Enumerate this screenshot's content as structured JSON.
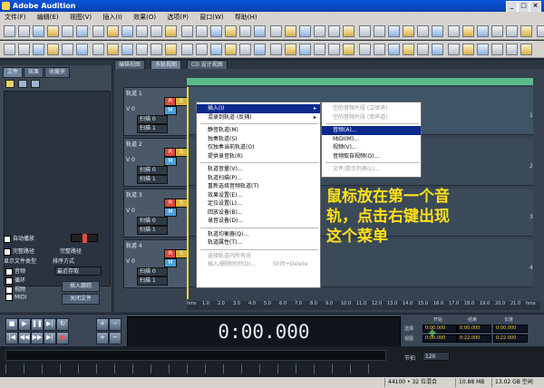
{
  "window": {
    "title": "Adobe Audition",
    "controls": [
      "_",
      "□",
      "×"
    ]
  },
  "menubar": [
    "文件(F)",
    "编辑(E)",
    "视图(V)",
    "插入(I)",
    "效果(O)",
    "选项(P)",
    "窗口(W)",
    "帮助(H)"
  ],
  "organizer": {
    "tabs": [
      "文件",
      "效果",
      "收藏夹"
    ],
    "auto_play_label": "自动播放",
    "full_path_label": "完整路径",
    "show_type_label": "显示文件类型",
    "sort_label": "排序方式",
    "sort_value": "最近存取",
    "file_types": [
      "音频",
      "循环",
      "视频",
      "MIDI"
    ],
    "btn_insert": "插入跟踪",
    "btn_close": "关闭文件"
  },
  "view_tabs": [
    "编辑视图",
    "多轨视图",
    "CD 设计视图"
  ],
  "tracks": [
    {
      "name": "轨道 1",
      "vol": "V 0",
      "rec": "录音",
      "out": "扫描 0",
      "out2": "扫描 1"
    },
    {
      "name": "轨道 2",
      "vol": "V 0",
      "rec": "录音",
      "out": "扫描 0",
      "out2": "扫描 1"
    },
    {
      "name": "轨道 3",
      "vol": "V 0",
      "rec": "录音",
      "out": "扫描 0",
      "out2": "扫描 1"
    },
    {
      "name": "轨道 4",
      "vol": "V 0",
      "rec": "录音",
      "out": "扫描 0",
      "out2": "扫描 1"
    }
  ],
  "track_numbers": [
    "1",
    "2",
    "3",
    "4"
  ],
  "ruler": [
    "hms",
    "1.0",
    "2.0",
    "3.0",
    "4.0",
    "5.0",
    "6.0",
    "7.0",
    "8.0",
    "9.0",
    "10.0",
    "11.0",
    "12.0",
    "13.0",
    "14.0",
    "15.0",
    "16.0",
    "17.0",
    "18.0",
    "19.0",
    "20.0",
    "21.0",
    "hms"
  ],
  "context_menu": {
    "items": [
      {
        "label": "插入(I)",
        "arrow": "▸",
        "highlight": true
      },
      {
        "label": "混录到轨道 (反捕)",
        "arrow": "▸"
      },
      {
        "sep": true
      },
      {
        "label": "静音轨道(M)"
      },
      {
        "label": "独奏轨道(S)"
      },
      {
        "label": "仅独奏当前轨道(O)"
      },
      {
        "label": "提供录音轨(R)"
      },
      {
        "sep": true
      },
      {
        "label": "轨道音量(V)..."
      },
      {
        "label": "轨道扫描(P)..."
      },
      {
        "label": "重新选择音频轨道(T)"
      },
      {
        "label": "效果设置(E)..."
      },
      {
        "label": "定位设置(L)..."
      },
      {
        "label": "回放设备(B)..."
      },
      {
        "label": "录音设备(D)..."
      },
      {
        "sep": true
      },
      {
        "label": "轨道均衡器(Q)..."
      },
      {
        "label": "轨道属性(T)..."
      },
      {
        "sep": true
      },
      {
        "label": "选择轨道内所有块",
        "disabled": true
      },
      {
        "label": "插入/删除时间(D)...",
        "shortcut": "Shift+Delete",
        "disabled": true
      }
    ]
  },
  "submenu": {
    "items": [
      {
        "label": "空的音频片段 (立体声)",
        "disabled": true
      },
      {
        "label": "空的音频片段 (单声道)",
        "disabled": true
      },
      {
        "sep": true
      },
      {
        "label": "音频(A)...",
        "highlight": true
      },
      {
        "label": "MIDI(M)..."
      },
      {
        "label": "视频(V)..."
      },
      {
        "label": "音频取自视频(O)..."
      },
      {
        "sep": true
      },
      {
        "label": "文件/提示列表(L)...",
        "disabled": true
      }
    ]
  },
  "annotation": [
    "鼠标放在第一个音",
    "轨，点击右键出现",
    "这个菜单"
  ],
  "transport": {
    "time": "0:00.000",
    "headers": [
      "开始",
      "结束",
      "长度"
    ],
    "rows": [
      {
        "label": "选择",
        "start": "0:00.000",
        "end": "0:00.000",
        "length": "0:00.000"
      },
      {
        "label": "视图",
        "start": "0:00.000",
        "end": "0:22.000",
        "length": "0:22.000"
      }
    ],
    "tempo_label": "节拍",
    "tempo_value": "120"
  },
  "statusbar": [
    "44100 • 32 位混合",
    "10.88 MB",
    "13.02 GB 空闲"
  ]
}
